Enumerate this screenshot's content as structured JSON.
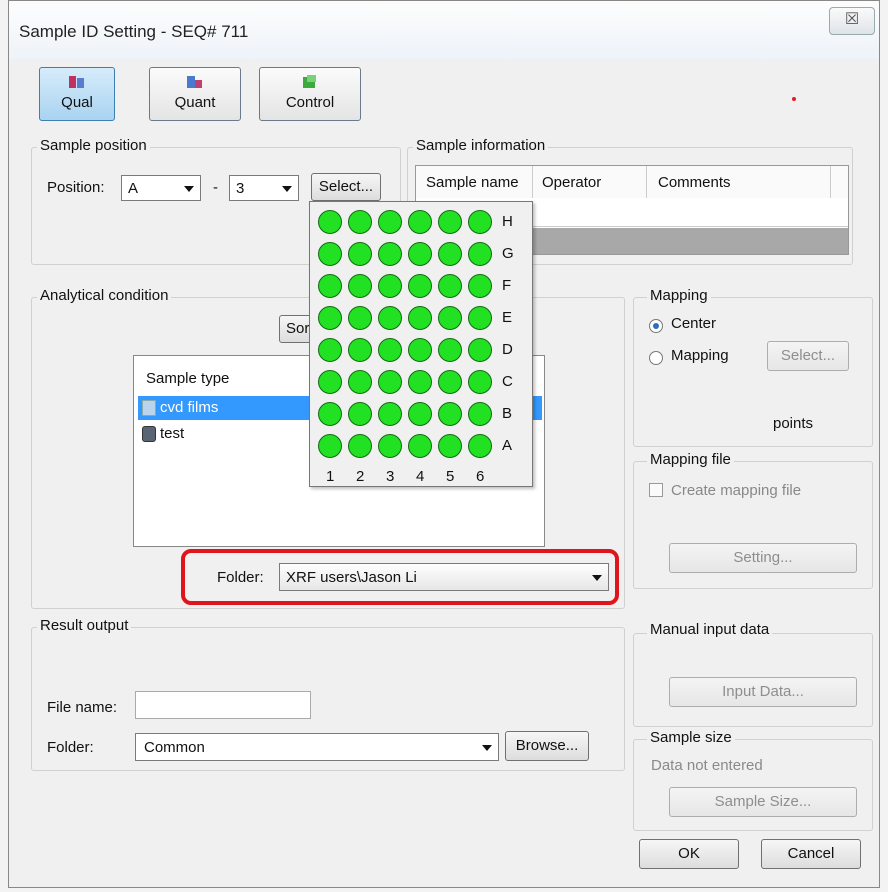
{
  "window": {
    "title": "Sample ID Setting - SEQ# 711",
    "close_glyph": "☒"
  },
  "toolbar": {
    "qual": "Qual",
    "quant": "Quant",
    "control": "Control"
  },
  "sample_position": {
    "label": "Sample position",
    "position_label": "Position:",
    "row_value": "A",
    "separator": "-",
    "col_value": "3",
    "select_label": "Select..."
  },
  "sample_information": {
    "label": "Sample information",
    "columns": [
      "Sample name",
      "Operator",
      "Comments"
    ]
  },
  "grid": {
    "rows": [
      "H",
      "G",
      "F",
      "E",
      "D",
      "C",
      "B",
      "A"
    ],
    "cols": [
      "1",
      "2",
      "3",
      "4",
      "5",
      "6"
    ],
    "color": "#22e022"
  },
  "analytical": {
    "label": "Analytical condition",
    "sort_label": "Sor",
    "list_header": "Sample type",
    "items": [
      "cvd films",
      "test"
    ],
    "folder_label": "Folder:",
    "folder_value": "XRF users\\Jason Li",
    "highlight_color": "#e0141b"
  },
  "mapping": {
    "label": "Mapping",
    "center": "Center",
    "mapping": "Mapping",
    "select": "Select...",
    "points": "points"
  },
  "mapping_file": {
    "label": "Mapping file",
    "create": "Create mapping file",
    "setting": "Setting..."
  },
  "result_output": {
    "label": "Result output",
    "file_name_label": "File name:",
    "folder_label": "Folder:",
    "folder_value": "Common",
    "browse": "Browse..."
  },
  "manual_input": {
    "label": "Manual input data",
    "button": "Input Data..."
  },
  "sample_size": {
    "label": "Sample size",
    "status": "Data not entered",
    "button": "Sample Size..."
  },
  "dialog": {
    "ok": "OK",
    "cancel": "Cancel"
  }
}
